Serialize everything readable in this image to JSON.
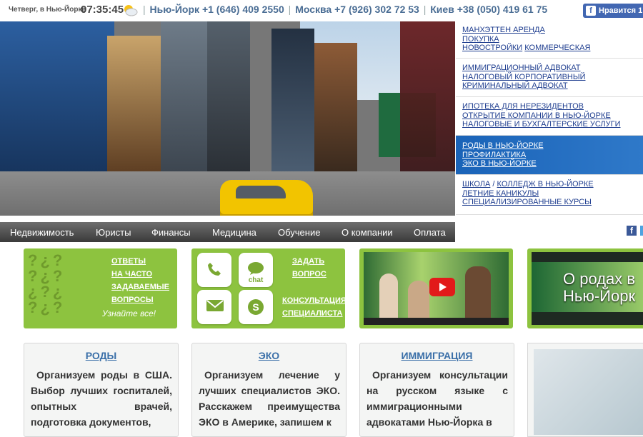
{
  "topbar": {
    "day": "Четверг, в Нью-Йорке",
    "time": "07:35:45",
    "weather_icon": "partly-cloudy-icon",
    "contacts": [
      {
        "city": "Нью-Йорк",
        "phone": "+1 (646) 409 2550"
      },
      {
        "city": "Москва",
        "phone": "+7 (926) 302 72 53"
      },
      {
        "city": "Киев",
        "phone": "+38 (050) 419 61 75"
      }
    ],
    "fb_like": "Нравится 1"
  },
  "right_links": [
    {
      "lines": [
        [
          "МАНХЭТТЕН АРЕНДА"
        ],
        [
          "ПОКУПКА"
        ],
        [
          "НОВОСТРОЙКИ",
          "КОММЕРЧЕСКАЯ"
        ]
      ]
    },
    {
      "lines": [
        [
          "ИММИГРАЦИОННЫЙ АДВОКАТ"
        ],
        [
          "НАЛОГОВЫЙ КОРПОРАТИВНЫЙ"
        ],
        [
          "КРИМИНАЛЬНЫЙ АДВОКАТ"
        ]
      ]
    },
    {
      "lines": [
        [
          "ИПОТЕКА ДЛЯ НЕРЕЗИДЕНТОВ"
        ],
        [
          "ОТКРЫТИЕ КОМПАНИИ В НЬЮ-ЙОРКЕ"
        ],
        [
          "НАЛОГОВЫЕ И БУХГАЛТЕРСКИЕ УСЛУГИ"
        ]
      ]
    },
    {
      "lines": [
        [
          "РОДЫ В НЬЮ-ЙОРКЕ"
        ],
        [
          "ПРОФИЛАКТИКА"
        ],
        [
          "ЭКО В НЬЮ-ЙОРКЕ"
        ]
      ]
    },
    {
      "lines": [
        [
          "ШКОЛА",
          "КОЛЛЕДЖ В НЬЮ-ЙОРКЕ"
        ],
        [
          "ЛЕТНИЕ КАНИКУЛЫ"
        ],
        [
          "СПЕЦИАЛИЗИРОВАННЫЕ КУРСЫ"
        ]
      ]
    }
  ],
  "nav": [
    "Недвижимость",
    "Юристы",
    "Финансы",
    "Медицина",
    "Обучение",
    "О компании",
    "Оплата"
  ],
  "faq": {
    "links": [
      "ОТВЕТЫ",
      "НА ЧАСТО",
      "ЗАДАВАЕМЫЕ",
      "ВОПРОСЫ"
    ],
    "cta": "Узнайте все!"
  },
  "contact_box": {
    "chat_label": "chat",
    "ask": [
      "ЗАДАТЬ",
      "ВОПРОС"
    ],
    "consult": [
      "КОНСУЛЬТАЦИЯ",
      "СПЕЦИАЛИСТА"
    ],
    "icons": [
      "phone-icon",
      "chat-icon",
      "mail-icon",
      "skype-icon"
    ]
  },
  "video2_title": [
    "О родах в",
    "Нью-Йорк"
  ],
  "cards": [
    {
      "title": "РОДЫ",
      "text": "Организуем роды в США. Выбор лучших госпиталей, опытных врачей, подготовка документов,"
    },
    {
      "title": "ЭКО",
      "text": "Организуем лечение у лучших специалистов ЭКО. Расскажем преимущества ЭКО в Америке, запишем к"
    },
    {
      "title": "ИММИГРАЦИЯ",
      "text": "Организуем консультации на русском языке с иммиграционными адвокатами Нью-Йорка в"
    }
  ],
  "colors": {
    "green": "#8dc33f",
    "link_blue": "#1e3d8f",
    "nav_dark": "#3a3a3a",
    "active_blue": "#1a63b8"
  }
}
